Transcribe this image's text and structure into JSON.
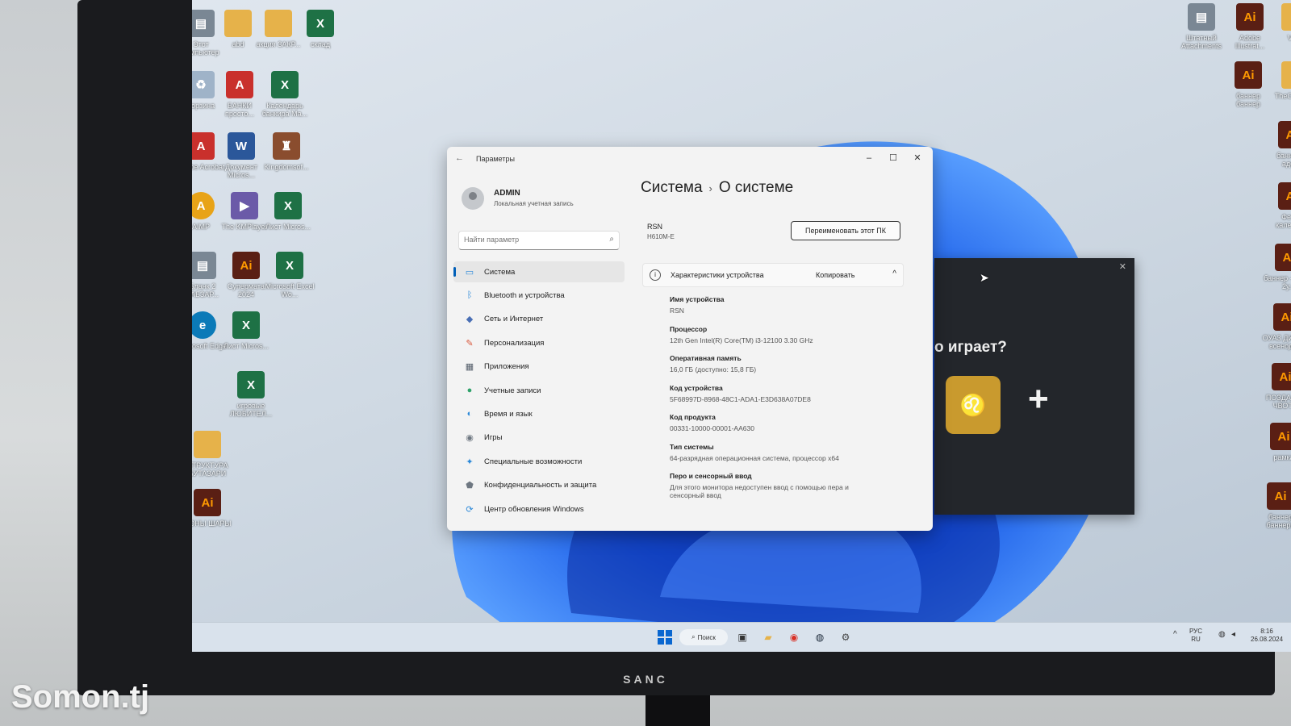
{
  "desktop": {
    "left_icons": [
      {
        "label": "Этот компьютер",
        "kind": "gen"
      },
      {
        "label": "abd",
        "kind": "folder"
      },
      {
        "label": "акция ЗАКР...",
        "kind": "folder"
      },
      {
        "label": "склад",
        "kind": "excel"
      },
      {
        "label": "Корзина",
        "kind": "bin"
      },
      {
        "label": "БАНКИ просто...",
        "kind": "pdf"
      },
      {
        "label": "Календарь банкира Ма...",
        "kind": "excel"
      },
      {
        "label": "Adobe Acrobat",
        "kind": "pdf"
      },
      {
        "label": "Документ Micros...",
        "kind": "word"
      },
      {
        "label": "Kingdomsof...",
        "kind": "kg"
      },
      {
        "label": "AIMP",
        "kind": "aimp"
      },
      {
        "label": "The KMPlayer",
        "kind": "kmp"
      },
      {
        "label": "Лист Micros...",
        "kind": "excel"
      },
      {
        "label": "Бланк 2 КАБЗАР...",
        "kind": "gen"
      },
      {
        "label": "Супермата 2024",
        "kind": "ai"
      },
      {
        "label": "Microsoft Excel Wo...",
        "kind": "excel"
      },
      {
        "label": "Microsoft Edge",
        "kind": "edge"
      },
      {
        "label": "Лист Micros...",
        "kind": "excel"
      },
      {
        "label": "игровые ЛЮБИТЕЛ...",
        "kind": "excel"
      },
      {
        "label": "СТРУКТУРА БУТАЗАРИ",
        "kind": "folder"
      },
      {
        "label": "ФОНЫ ШАРЫ",
        "kind": "ai"
      }
    ],
    "right_icons": [
      {
        "label": "Штатный Attachments",
        "kind": "gen"
      },
      {
        "label": "Adobe Illustrat...",
        "kind": "ai"
      },
      {
        "label": "VED",
        "kind": "folder"
      },
      {
        "label": "баннер баннер",
        "kind": "ai"
      },
      {
        "label": "TheOfficial...",
        "kind": "folder"
      },
      {
        "label": "баннер-2 адент",
        "kind": "ai"
      },
      {
        "label": "Фетон календар",
        "kind": "ai"
      },
      {
        "label": "баннер - стенд 2у...",
        "kind": "ai"
      },
      {
        "label": "ОУАЗ ДИ 2024 всенодная",
        "kind": "ai"
      },
      {
        "label": "ПОЗДАЛКА ЧВОТО",
        "kind": "ai"
      },
      {
        "label": "рамка",
        "kind": "ai"
      },
      {
        "label": "баннер баннер2",
        "kind": "ai"
      }
    ]
  },
  "settings": {
    "app_title": "Параметры",
    "back_icon": "←",
    "window_controls": {
      "minimize": "–",
      "maximize": "☐",
      "close": "✕"
    },
    "user": {
      "name": "ADMIN",
      "account_type": "Локальная учетная запись"
    },
    "search": {
      "placeholder": "Найти параметр",
      "icon": "⌕"
    },
    "nav": [
      {
        "label": "Система",
        "icon": "▭",
        "color": "#2b88d8",
        "active": true
      },
      {
        "label": "Bluetooth и устройства",
        "icon": "ᛒ",
        "color": "#2b88d8",
        "active": false
      },
      {
        "label": "Сеть и Интернет",
        "icon": "◆",
        "color": "#4a6fb5",
        "active": false
      },
      {
        "label": "Персонализация",
        "icon": "✎",
        "color": "#d9573b",
        "active": false
      },
      {
        "label": "Приложения",
        "icon": "▦",
        "color": "#555f6b",
        "active": false
      },
      {
        "label": "Учетные записи",
        "icon": "●",
        "color": "#2fa26a",
        "active": false
      },
      {
        "label": "Время и язык",
        "icon": "◐",
        "color": "#2b88d8",
        "active": false
      },
      {
        "label": "Игры",
        "icon": "◉",
        "color": "#6e7781",
        "active": false
      },
      {
        "label": "Специальные возможности",
        "icon": "✦",
        "color": "#2b88d8",
        "active": false
      },
      {
        "label": "Конфиденциальность и защита",
        "icon": "⬟",
        "color": "#6e7781",
        "active": false
      },
      {
        "label": "Центр обновления Windows",
        "icon": "⟳",
        "color": "#2b88d8",
        "active": false
      }
    ],
    "breadcrumb": {
      "parent": "Система",
      "separator": "›",
      "current": "О системе"
    },
    "pc": {
      "name": "RSN",
      "model": "H610M-E",
      "rename_button": "Переименовать этот ПК"
    },
    "specs": {
      "header": "Характеристики устройства",
      "copy_button": "Копировать",
      "info_icon": "i",
      "collapse_icon": "^",
      "rows": [
        {
          "key": "Имя устройства",
          "value": "RSN"
        },
        {
          "key": "Процессор",
          "value": "12th Gen Intel(R) Core(TM) i3-12100   3.30 GHz"
        },
        {
          "key": "Оперативная память",
          "value": "16,0 ГБ (доступно: 15,8 ГБ)"
        },
        {
          "key": "Код устройства",
          "value": "5F68997D-8968-48C1-ADA1-E3D638A07DE8"
        },
        {
          "key": "Код продукта",
          "value": "00331-10000-00001-AA630"
        },
        {
          "key": "Тип системы",
          "value": "64-разрядная операционная система, процессор x64"
        },
        {
          "key": "Перо и сенсорный ввод",
          "value": "Для этого монитора недоступен ввод с помощью пера и сенсорный ввод"
        }
      ]
    }
  },
  "popup": {
    "question": "о играет?",
    "close_icon": "✕",
    "plus": "+",
    "logo_letter": "♌"
  },
  "taskbar": {
    "search_label": "Поиск",
    "search_icon": "⌕",
    "apps": [
      {
        "name": "task-view",
        "icon": "▣",
        "color": "#333"
      },
      {
        "name": "file-explorer",
        "icon": "▰",
        "color": "#e6b24a"
      },
      {
        "name": "chrome",
        "icon": "◉",
        "color": "#d93025"
      },
      {
        "name": "steam",
        "icon": "◍",
        "color": "#1b2838"
      },
      {
        "name": "settings",
        "icon": "⚙",
        "color": "#444"
      }
    ],
    "tray": {
      "chevron": "^",
      "lang_top": "РУС",
      "lang_bottom": "RU",
      "time": "8:16",
      "date": "26.08.2024"
    }
  },
  "monitor_brand": "SANC",
  "watermark": "Somon.tj"
}
